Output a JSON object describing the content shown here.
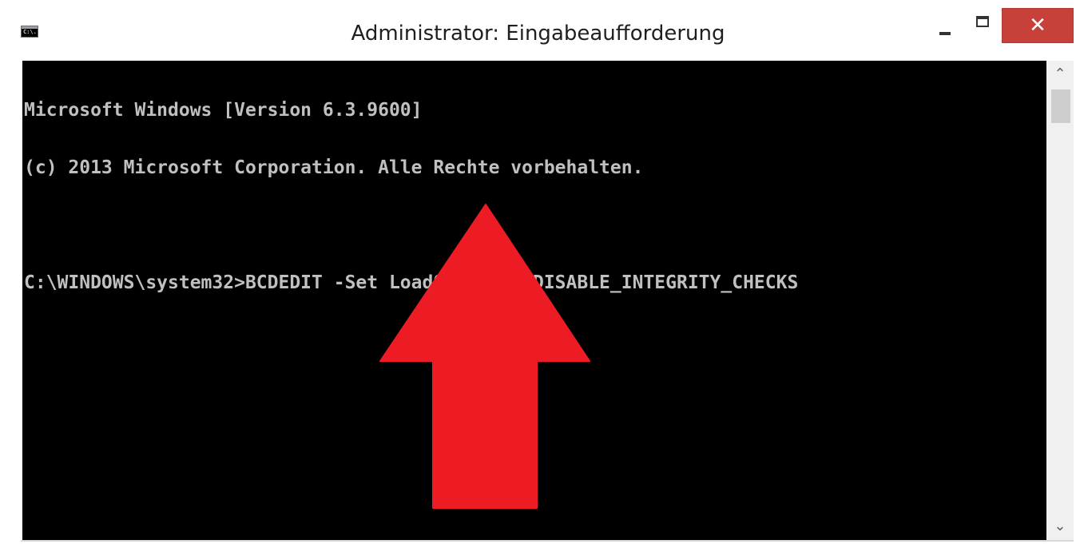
{
  "window": {
    "title": "Administrator: Eingabeaufforderung",
    "icon_label": "C:\\.",
    "controls": {
      "minimize_icon": "minimize-icon",
      "maximize_icon": "maximize-icon",
      "close_symbol": "✕",
      "close_color": "#c7413a"
    }
  },
  "console": {
    "lines": [
      "Microsoft Windows [Version 6.3.9600]",
      "(c) 2013 Microsoft Corporation. Alle Rechte vorbehalten.",
      "",
      "C:\\WINDOWS\\system32>BCDEDIT -Set LoadOptions DDISABLE_INTEGRITY_CHECKS"
    ],
    "text_color": "#c0c0c0",
    "background": "#000000"
  },
  "annotation": {
    "shape": "up-arrow",
    "color": "#ed1c24"
  },
  "scrollbar": {
    "up_symbol": "⌃",
    "down_symbol": "⌄"
  }
}
